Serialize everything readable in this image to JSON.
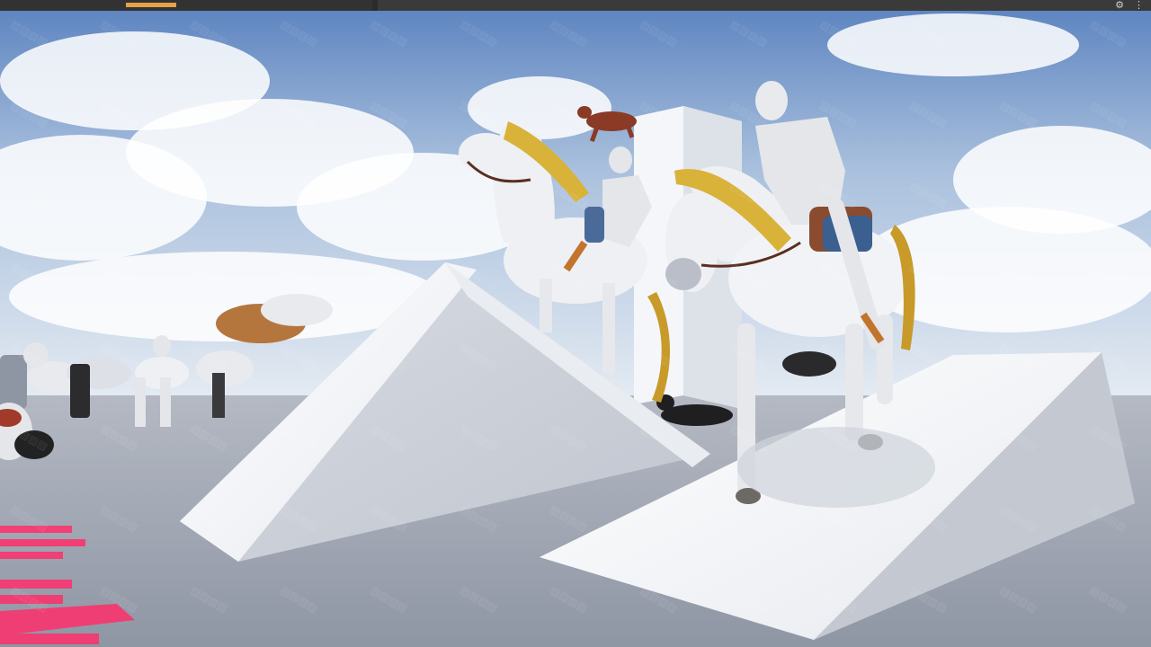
{
  "editor": {
    "toolbar": {
      "settings_icon": "gear-icon",
      "menu_icon": "more-vertical-icon"
    }
  },
  "scene": {
    "sky_top": "#5f86c1",
    "sky_bottom": "#dbe5f0",
    "ground": "#9aa1ad",
    "ramp_face": "#f3f5f8",
    "ramp_side": "#c9cdd6",
    "horse_body": "#eef0f3",
    "horse_mane": "#d9b23a",
    "rider_body": "#e4e6ea",
    "floor_text_color": "#ff2e6a",
    "watermark_color": "#ffffff"
  }
}
